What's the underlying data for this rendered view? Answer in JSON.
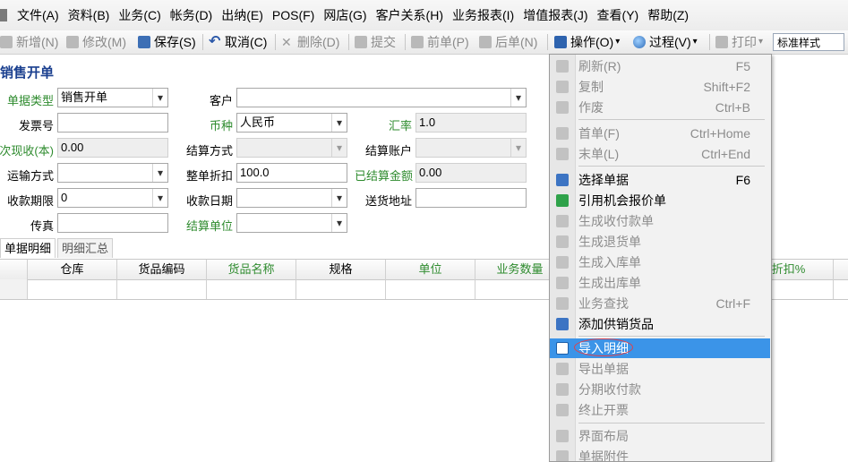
{
  "menubar": {
    "items": [
      "文件(A)",
      "资料(B)",
      "业务(C)",
      "帐务(D)",
      "出纳(E)",
      "POS(F)",
      "网店(G)",
      "客户关系(H)",
      "业务报表(I)",
      "增值报表(J)",
      "查看(Y)",
      "帮助(Z)"
    ]
  },
  "toolbar": {
    "new": "新增(N)",
    "modify": "修改(M)",
    "save": "保存(S)",
    "cancel": "取消(C)",
    "delete": "删除(D)",
    "submit": "提交",
    "prev": "前单(P)",
    "next": "后单(N)",
    "operate": "操作(O)",
    "process": "过程(V)",
    "print": "打印",
    "style": "标准样式"
  },
  "page": {
    "title": "销售开单"
  },
  "form": {
    "doc_type_label": "单据类型",
    "doc_type_value": "销售开单",
    "customer_label": "客户",
    "customer_value": "",
    "invoice_no_label": "发票号",
    "invoice_no_value": "",
    "currency_label": "币种",
    "currency_value": "人民币",
    "rate_label": "汇率",
    "rate_value": "1.0",
    "cash_label": "次现收(本)",
    "cash_value": "0.00",
    "settle_method_label": "结算方式",
    "settle_method_value": "",
    "settle_account_label": "结算账户",
    "settle_account_value": "",
    "transport_label": "运输方式",
    "transport_value": "",
    "discount_label": "整单折扣",
    "discount_value": "100.0",
    "settled_amount_label": "已结算金额",
    "settled_amount_value": "0.00",
    "payment_term_label": "收款期限",
    "payment_term_value": "0",
    "payment_date_label": "收款日期",
    "payment_date_value": "",
    "delivery_addr_label": "送货地址",
    "delivery_addr_value": "",
    "fax_label": "传真",
    "fax_value": "",
    "settle_unit_label": "结算单位",
    "settle_unit_value": ""
  },
  "tabs": [
    "单据明细",
    "明细汇总"
  ],
  "grid": {
    "columns": [
      "仓库",
      "货品编码",
      "货品名称",
      "规格",
      "单位",
      "业务数量",
      "折扣%"
    ]
  },
  "dropdown": {
    "items": [
      {
        "label": "刷新(R)",
        "key": "F5",
        "state": "disabled"
      },
      {
        "label": "复制",
        "key": "Shift+F2",
        "state": "disabled"
      },
      {
        "label": "作废",
        "key": "Ctrl+B",
        "state": "disabled"
      },
      {
        "label": "首单(F)",
        "key": "Ctrl+Home",
        "state": "disabled"
      },
      {
        "label": "末单(L)",
        "key": "Ctrl+End",
        "state": "disabled"
      },
      {
        "label": "选择单据",
        "key": "F6",
        "state": "enabled"
      },
      {
        "label": "引用机会报价单",
        "key": "",
        "state": "enabled"
      },
      {
        "label": "生成收付款单",
        "key": "",
        "state": "disabled"
      },
      {
        "label": "生成退货单",
        "key": "",
        "state": "disabled"
      },
      {
        "label": "生成入库单",
        "key": "",
        "state": "disabled"
      },
      {
        "label": "生成出库单",
        "key": "",
        "state": "disabled"
      },
      {
        "label": "业务查找",
        "key": "Ctrl+F",
        "state": "disabled"
      },
      {
        "label": "添加供销货品",
        "key": "",
        "state": "enabled"
      },
      {
        "label": "导入明细",
        "key": "",
        "state": "highlighted"
      },
      {
        "label": "导出单据",
        "key": "",
        "state": "disabled"
      },
      {
        "label": "分期收付款",
        "key": "",
        "state": "disabled"
      },
      {
        "label": "终止开票",
        "key": "",
        "state": "disabled"
      },
      {
        "label": "界面布局",
        "key": "",
        "state": "disabled"
      },
      {
        "label": "单据附件",
        "key": "",
        "state": "disabled"
      }
    ]
  }
}
